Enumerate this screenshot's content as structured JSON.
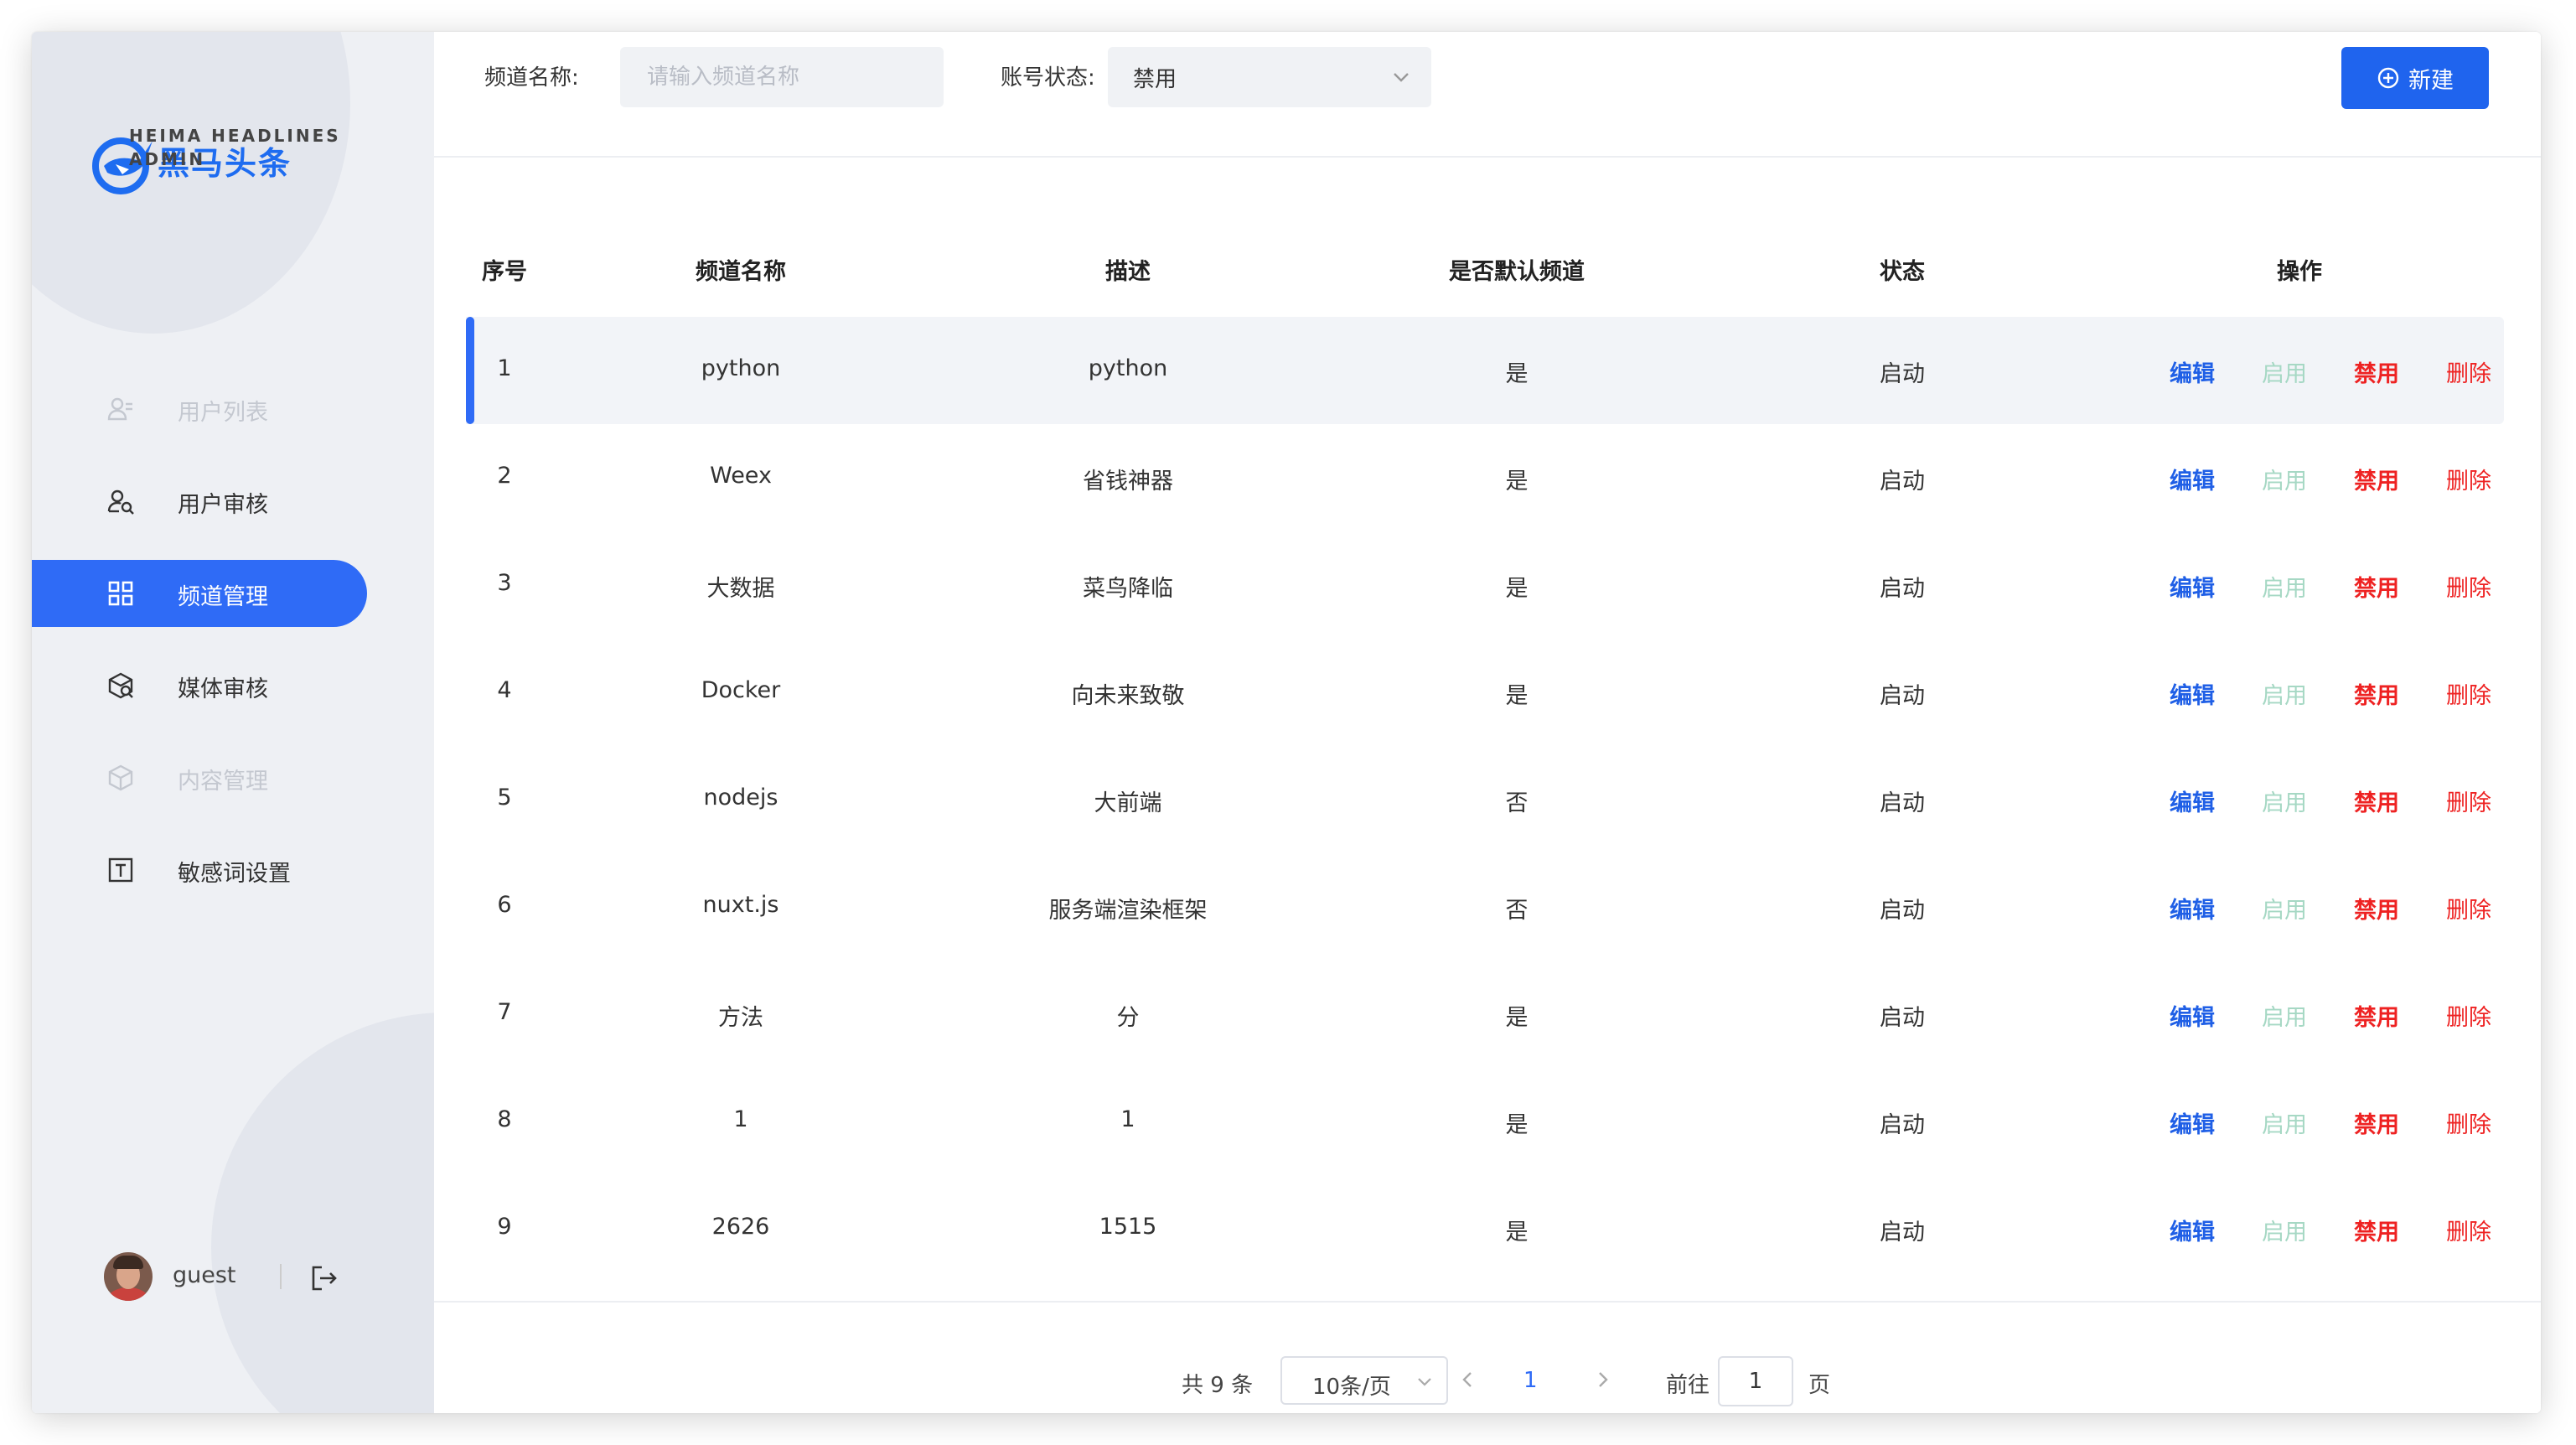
{
  "brand": {
    "name_cn": "黑马头条",
    "name_en_line1": "HEIMA HEADLINES",
    "name_en_line2": "ADMIN",
    "color": "#1e6cf0"
  },
  "sidebar": {
    "items": [
      {
        "label": "用户列表",
        "icon": "user-list-icon",
        "state": "disabled"
      },
      {
        "label": "用户审核",
        "icon": "user-search-icon",
        "state": "normal"
      },
      {
        "label": "频道管理",
        "icon": "grid-icon",
        "state": "active"
      },
      {
        "label": "媒体审核",
        "icon": "media-review-icon",
        "state": "normal"
      },
      {
        "label": "内容管理",
        "icon": "box-icon",
        "state": "disabled"
      },
      {
        "label": "敏感词设置",
        "icon": "text-box-icon",
        "state": "normal"
      }
    ],
    "active_color": "#2f6bf6"
  },
  "user": {
    "name": "guest"
  },
  "filters": {
    "channel_name_label": "频道名称:",
    "channel_name_placeholder": "请输入频道名称",
    "status_label": "账号状态:",
    "status_value": "禁用",
    "new_button": "新建"
  },
  "table": {
    "headers": {
      "index": "序号",
      "name": "频道名称",
      "desc": "描述",
      "is_default": "是否默认频道",
      "status": "状态",
      "actions": "操作"
    },
    "action_labels": {
      "edit": "编辑",
      "enable": "启用",
      "disable": "禁用",
      "delete": "删除"
    },
    "rows": [
      {
        "index": "1",
        "name": "python",
        "desc": "python",
        "is_default": "是",
        "status": "启动"
      },
      {
        "index": "2",
        "name": "Weex",
        "desc": "省钱神器",
        "is_default": "是",
        "status": "启动"
      },
      {
        "index": "3",
        "name": "大数据",
        "desc": "菜鸟降临",
        "is_default": "是",
        "status": "启动"
      },
      {
        "index": "4",
        "name": "Docker",
        "desc": "向未来致敬",
        "is_default": "是",
        "status": "启动"
      },
      {
        "index": "5",
        "name": "nodejs",
        "desc": "大前端",
        "is_default": "否",
        "status": "启动"
      },
      {
        "index": "6",
        "name": "nuxt.js",
        "desc": "服务端渲染框架",
        "is_default": "否",
        "status": "启动"
      },
      {
        "index": "7",
        "name": "方法",
        "desc": "分",
        "is_default": "是",
        "status": "启动"
      },
      {
        "index": "8",
        "name": "1",
        "desc": "1",
        "is_default": "是",
        "status": "启动"
      },
      {
        "index": "9",
        "name": "2626",
        "desc": "1515",
        "is_default": "是",
        "status": "启动"
      }
    ]
  },
  "pagination": {
    "total": "共 9 条",
    "page_size": "10条/页",
    "current_page": "1",
    "goto_label": "前往",
    "goto_value": "1",
    "page_unit": "页"
  }
}
